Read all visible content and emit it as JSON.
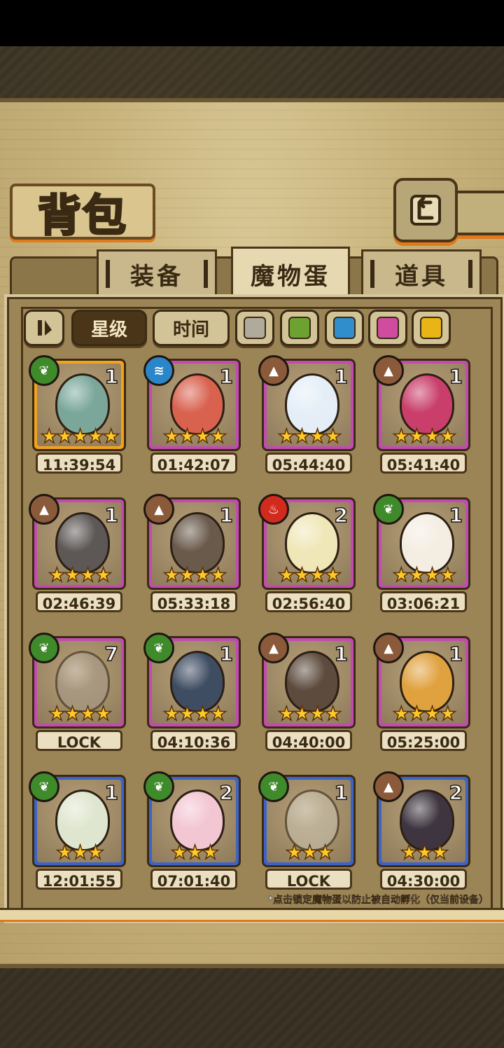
{
  "title": "背包",
  "tabs": [
    {
      "label": "装备",
      "active": false
    },
    {
      "label": "魔物蛋",
      "active": true
    },
    {
      "label": "道具",
      "active": false
    }
  ],
  "filters": {
    "sort_icon": "sort-toggle-icon",
    "star": "星级",
    "time": "时间",
    "colors": [
      {
        "name": "gray",
        "hex": "#b0aa9c"
      },
      {
        "name": "green",
        "hex": "#6da130"
      },
      {
        "name": "blue",
        "hex": "#2f8ecb"
      },
      {
        "name": "pink",
        "hex": "#cf4c9e"
      },
      {
        "name": "yellow",
        "hex": "#e9b416"
      }
    ]
  },
  "eggs": [
    {
      "element": "leaf",
      "count": "1",
      "stars": "★★★★★",
      "rarity": "orange",
      "timer": "11:39:54",
      "egg_color": "#7aa79a"
    },
    {
      "element": "water",
      "count": "1",
      "stars": "★★★★",
      "rarity": "purple",
      "timer": "01:42:07",
      "egg_color": "#d9624f"
    },
    {
      "element": "earth",
      "count": "1",
      "stars": "★★★★",
      "rarity": "purple",
      "timer": "05:44:40",
      "egg_color": "#e5eef7"
    },
    {
      "element": "earth",
      "count": "1",
      "stars": "★★★★",
      "rarity": "purple",
      "timer": "05:41:40",
      "egg_color": "#c93e6a"
    },
    {
      "element": "earth",
      "count": "1",
      "stars": "★★★★",
      "rarity": "purple",
      "timer": "02:46:39",
      "egg_color": "#5d5856"
    },
    {
      "element": "earth",
      "count": "1",
      "stars": "★★★★",
      "rarity": "purple",
      "timer": "05:33:18",
      "egg_color": "#6a5a4c"
    },
    {
      "element": "fire",
      "count": "2",
      "stars": "★★★★",
      "rarity": "purple",
      "timer": "02:56:40",
      "egg_color": "#f0e7b8"
    },
    {
      "element": "leaf",
      "count": "1",
      "stars": "★★★★",
      "rarity": "purple",
      "timer": "03:06:21",
      "egg_color": "#f4ede2"
    },
    {
      "element": "leaf",
      "count": "7",
      "stars": "★★★★",
      "rarity": "purple",
      "timer": "LOCK",
      "egg_color": "#a79a8c"
    },
    {
      "element": "leaf",
      "count": "1",
      "stars": "★★★★",
      "rarity": "purple",
      "timer": "04:10:36",
      "egg_color": "#3f4d63"
    },
    {
      "element": "earth",
      "count": "1",
      "stars": "★★★★",
      "rarity": "purple",
      "timer": "04:40:00",
      "egg_color": "#5d4b3d"
    },
    {
      "element": "earth",
      "count": "1",
      "stars": "★★★★",
      "rarity": "purple",
      "timer": "05:25:00",
      "egg_color": "#e0a23f"
    },
    {
      "element": "leaf",
      "count": "1",
      "stars": "★★★",
      "rarity": "blue",
      "timer": "12:01:55",
      "egg_color": "#dfe6cf"
    },
    {
      "element": "leaf",
      "count": "2",
      "stars": "★★★",
      "rarity": "blue",
      "timer": "07:01:40",
      "egg_color": "#f3c6d3"
    },
    {
      "element": "leaf",
      "count": "1",
      "stars": "★★★",
      "rarity": "blue",
      "timer": "LOCK",
      "egg_color": "#c9c5b4"
    },
    {
      "element": "earth",
      "count": "2",
      "stars": "★★★",
      "rarity": "blue",
      "timer": "04:30:00",
      "egg_color": "#3e3540"
    }
  ],
  "element_colors": {
    "leaf": "#3f8a2a",
    "water": "#2a86c9",
    "earth": "#8a5a3a",
    "fire": "#d32a1e"
  },
  "element_icons": {
    "leaf": "leaf-icon",
    "water": "water-icon",
    "earth": "mountain-icon",
    "fire": "flame-icon"
  },
  "rarity_colors": {
    "orange": "#f2a31c",
    "purple": "#c24bb2",
    "blue": "#3d63c4"
  },
  "note": "*点击锁定魔物蛋以防止被自动孵化（仅当前设备）"
}
